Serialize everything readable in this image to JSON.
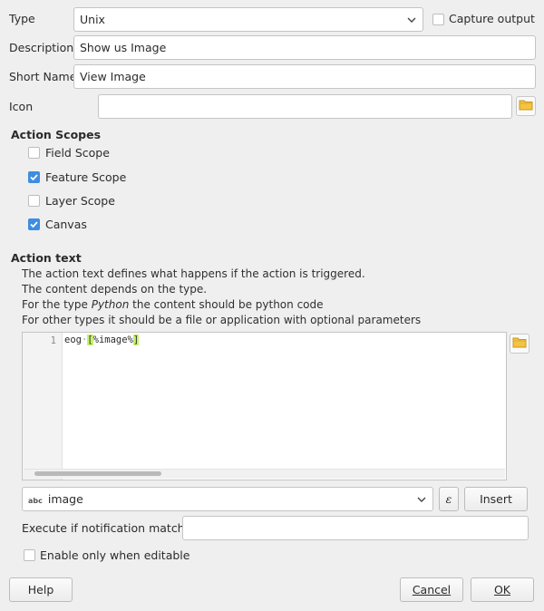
{
  "type": {
    "label": "Type",
    "value": "Unix",
    "capture_output_label": "Capture output",
    "capture_output_checked": false
  },
  "description": {
    "label": "Description",
    "value": "Show us Image"
  },
  "short_name": {
    "label": "Short Name",
    "value": "View Image"
  },
  "icon": {
    "label": "Icon",
    "value": ""
  },
  "action_scopes": {
    "title": "Action Scopes",
    "items": [
      {
        "label": "Field Scope",
        "checked": false
      },
      {
        "label": "Feature Scope",
        "checked": true
      },
      {
        "label": "Layer Scope",
        "checked": false
      },
      {
        "label": "Canvas",
        "checked": true
      }
    ]
  },
  "action_text": {
    "title": "Action text",
    "lines": [
      "The action text defines what happens if the action is triggered.",
      "The content depends on the type."
    ],
    "python_prefix": "For the type ",
    "python_word": "Python",
    "python_suffix": " the content should be python code",
    "line4": "For other types it should be a file or application with optional parameters"
  },
  "editor": {
    "line_number": "1",
    "code_prefix": "eog",
    "whitespace_marker": "·",
    "code_highlight_open": "[",
    "code_mid": "%image%",
    "code_highlight_close": "]"
  },
  "field_selector": {
    "type_badge": "abc",
    "value": "image"
  },
  "expression_symbol": "ε",
  "insert_label": "Insert",
  "notification": {
    "label": "Execute if notification matches",
    "value": ""
  },
  "editable_only": {
    "label": "Enable only when editable",
    "checked": false
  },
  "buttons": {
    "help": "Help",
    "cancel": "Cancel",
    "ok": "OK"
  }
}
